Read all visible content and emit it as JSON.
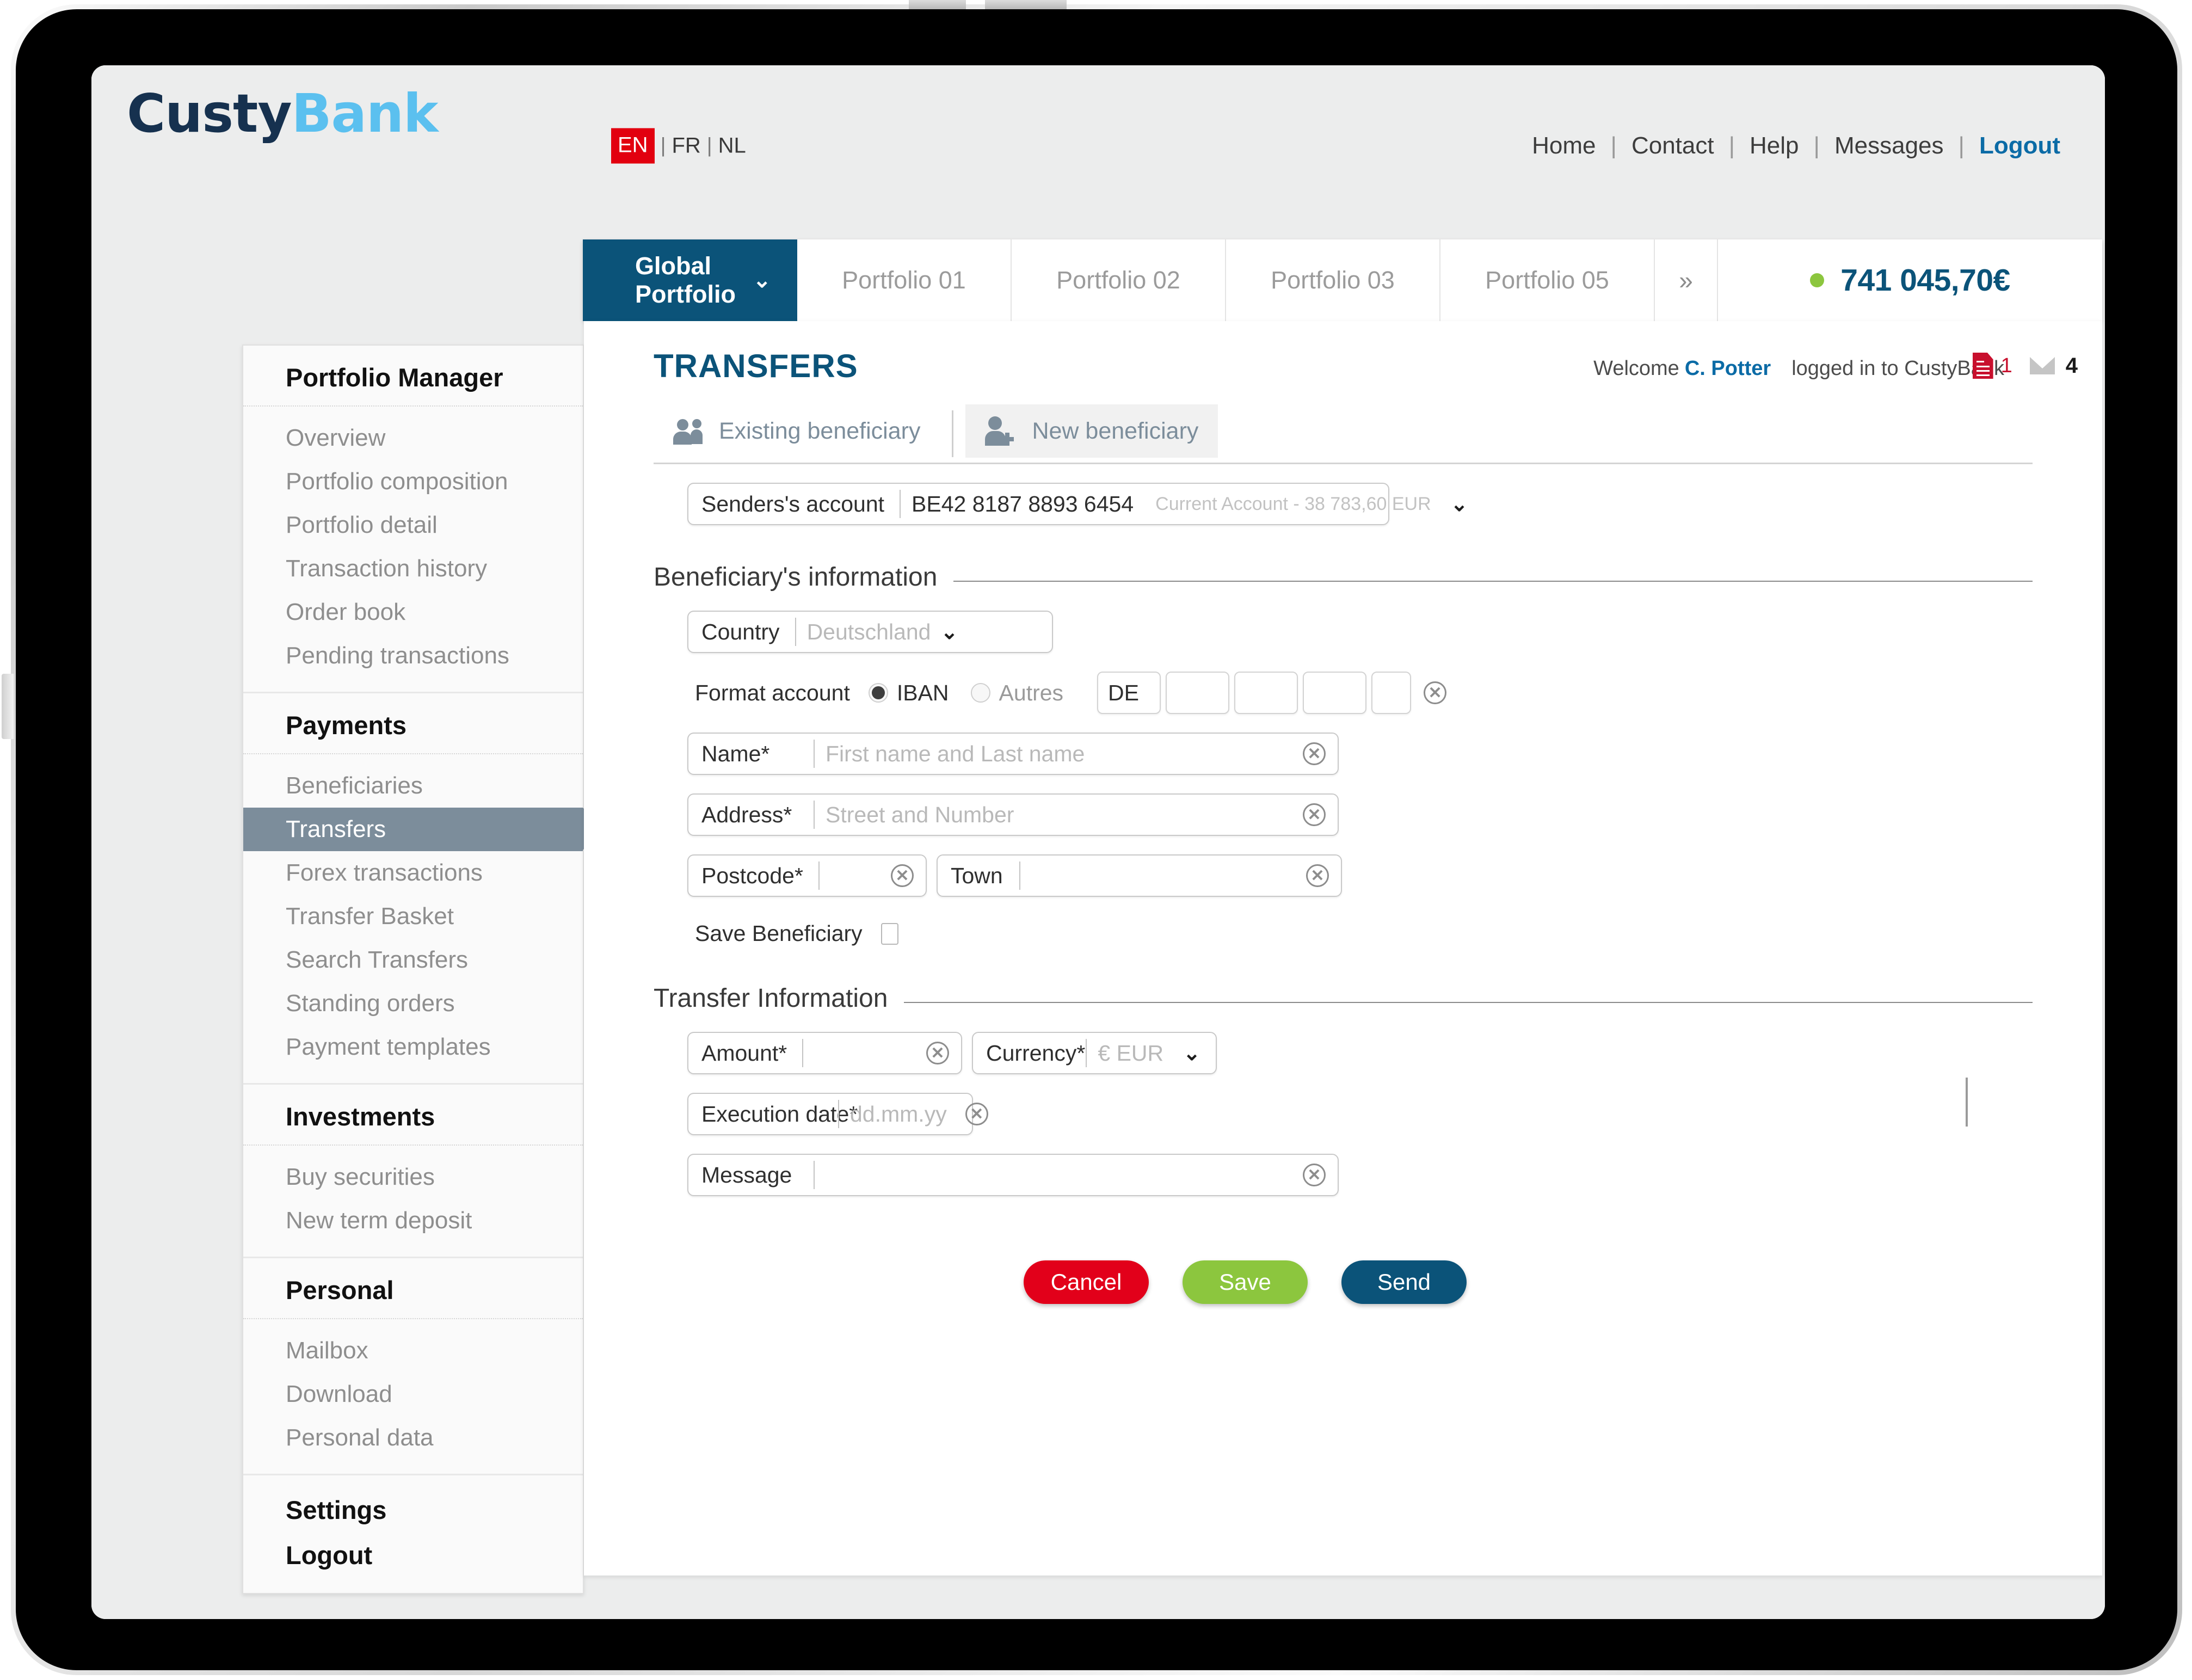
{
  "brand": {
    "part1": "Custy",
    "part2": "Bank"
  },
  "language": {
    "active": "EN",
    "options": [
      "EN",
      "FR",
      "NL"
    ],
    "separator": "|"
  },
  "topnav": {
    "items": [
      "Home",
      "Contact",
      "Help",
      "Messages"
    ],
    "logout": "Logout",
    "separator": "|"
  },
  "portfolio_tabs": {
    "active": {
      "label": "Global Portfolio",
      "chevron": "⌄"
    },
    "others": [
      "Portfolio 01",
      "Portfolio 02",
      "Portfolio 03",
      "Portfolio 05"
    ],
    "more_icon": "»",
    "balance": "741 045,70€",
    "status_color": "#8cc63e"
  },
  "sidebar": {
    "groups": [
      {
        "title": "Portfolio Manager",
        "items": [
          "Overview",
          "Portfolio composition",
          "Portfolio detail",
          "Transaction history",
          "Order book",
          "Pending transactions"
        ]
      },
      {
        "title": "Payments",
        "items": [
          "Beneficiaries",
          "Transfers",
          "Forex transactions",
          "Transfer Basket",
          "Search Transfers",
          "Standing orders",
          "Payment templates"
        ],
        "active_item": "Transfers"
      },
      {
        "title": "Investments",
        "items": [
          "Buy securities",
          "New term deposit"
        ]
      },
      {
        "title": "Personal",
        "items": [
          "Mailbox",
          "Download",
          "Personal data"
        ]
      }
    ],
    "footer_items": [
      "Settings",
      "Logout"
    ]
  },
  "content": {
    "page_title": "TRANSFERS",
    "welcome_prefix": "Welcome",
    "user_name": "C. Potter",
    "logged_in_text": "logged in to CustyBank",
    "documents_count": "1",
    "messages_count": "4"
  },
  "beneficiary_tabs": [
    {
      "label": "Existing beneficiary",
      "icon": "people-icon",
      "selected": false
    },
    {
      "label": "New beneficiary",
      "icon": "person-plus-icon",
      "selected": true
    }
  ],
  "sender": {
    "label": "Senders's account",
    "iban": "BE42 8187 8893 6454",
    "detail": "Current Account - 38 783,60 EUR",
    "caret": "⌄"
  },
  "beneficiary_section": {
    "heading": "Beneficiary's information",
    "country": {
      "label": "Country",
      "value": "Deutschland",
      "caret": "⌄"
    },
    "format_account": {
      "label": "Format account",
      "options": [
        {
          "label": "IBAN",
          "selected": true
        },
        {
          "label": "Autres",
          "selected": false
        }
      ],
      "iban_segments": [
        "DE",
        "",
        "",
        "",
        ""
      ],
      "clear_icon": "✕"
    },
    "name": {
      "label": "Name*",
      "placeholder": "First name and Last name",
      "value": ""
    },
    "address": {
      "label": "Address*",
      "placeholder": "Street and Number",
      "value": ""
    },
    "postcode": {
      "label": "Postcode*",
      "placeholder": "",
      "value": ""
    },
    "town": {
      "label": "Town",
      "placeholder": "",
      "value": ""
    },
    "save_beneficiary": {
      "label": "Save Beneficiary",
      "checked": false
    }
  },
  "transfer_section": {
    "heading": "Transfer Information",
    "amount": {
      "label": "Amount*",
      "value": ""
    },
    "currency": {
      "label": "Currency*",
      "value": "€ EUR",
      "caret": "⌄"
    },
    "execution_date": {
      "label": "Execution date*",
      "placeholder": "dd.mm.yy",
      "value": ""
    },
    "message": {
      "label": "Message",
      "value": ""
    }
  },
  "buttons": {
    "cancel": "Cancel",
    "save": "Save",
    "send": "Send",
    "cancel_color": "#e2001a",
    "save_color": "#8cc63e",
    "send_color": "#0b5379"
  },
  "colors": {
    "brand_dark": "#16314f",
    "brand_light": "#5bc0ef",
    "accent_blue": "#0b5379",
    "link_blue": "#0b6ba6",
    "red": "#e2000f",
    "green": "#8cc63e"
  }
}
